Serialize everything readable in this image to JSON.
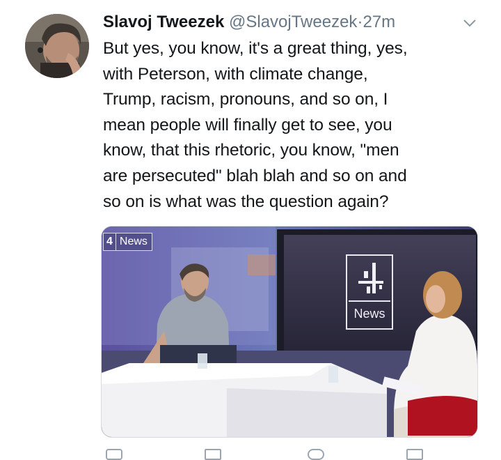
{
  "tweet": {
    "author_name": "Slavoj Tweezek",
    "handle": "@SlavojTweezek",
    "separator": "·",
    "time": "27m",
    "text_lines": [
      "But yes, you know, it's a great thing, yes,",
      "with Peterson, with climate change,",
      "Trump, racism, pronouns, and so on, I",
      "mean people will finally get to see, you",
      "know, that this rhetoric, you know, \"men",
      "are persecuted\" blah blah and so on and",
      "so on is what was the question again?"
    ]
  },
  "media": {
    "badge_number": "4",
    "badge_label": "News",
    "screen_label": "News"
  },
  "icons": {
    "menu": "chevron-down-icon"
  }
}
